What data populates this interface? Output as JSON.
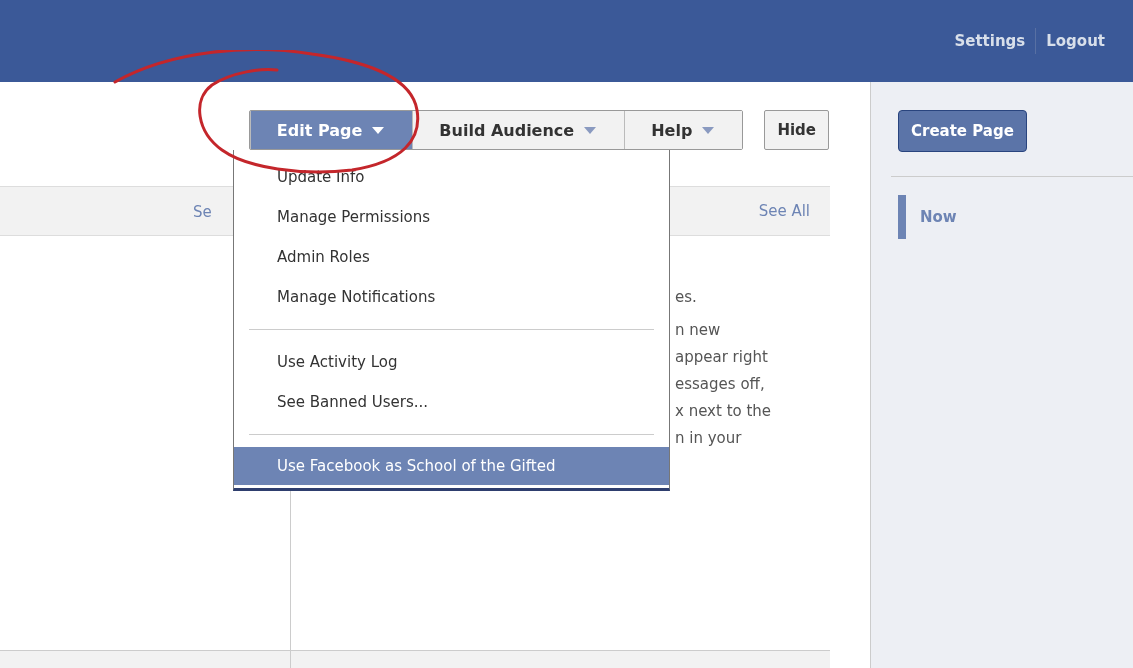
{
  "top_bar": {
    "links": [
      "Settings",
      "Logout"
    ]
  },
  "toolbar": {
    "menus": [
      {
        "label": "Edit Page",
        "selected": true
      },
      {
        "label": "Build Audience",
        "selected": false
      },
      {
        "label": "Help",
        "selected": false
      }
    ],
    "hide_button": "Hide"
  },
  "header": {
    "left_link": "Se",
    "right_link": "See All"
  },
  "content_lines": [
    "es.",
    "n new",
    "appear right",
    "essages off,",
    "x next to the",
    "n in your"
  ],
  "dropdown": {
    "items": [
      {
        "kind": "item",
        "label": "Update Info",
        "selected": false
      },
      {
        "kind": "item",
        "label": "Manage Permissions",
        "selected": false
      },
      {
        "kind": "item",
        "label": "Admin Roles",
        "selected": false
      },
      {
        "kind": "item",
        "label": "Manage Notifications",
        "selected": false
      },
      {
        "kind": "separator"
      },
      {
        "kind": "item",
        "label": "Use Activity Log",
        "selected": false
      },
      {
        "kind": "item",
        "label": "See Banned Users...",
        "selected": false
      },
      {
        "kind": "separator"
      },
      {
        "kind": "item",
        "label": "Use Facebook as School of the Gifted",
        "selected": true
      }
    ]
  },
  "sidebar": {
    "button": "Create Page",
    "timeline": [
      {
        "label": "Now",
        "selected": true
      }
    ]
  }
}
